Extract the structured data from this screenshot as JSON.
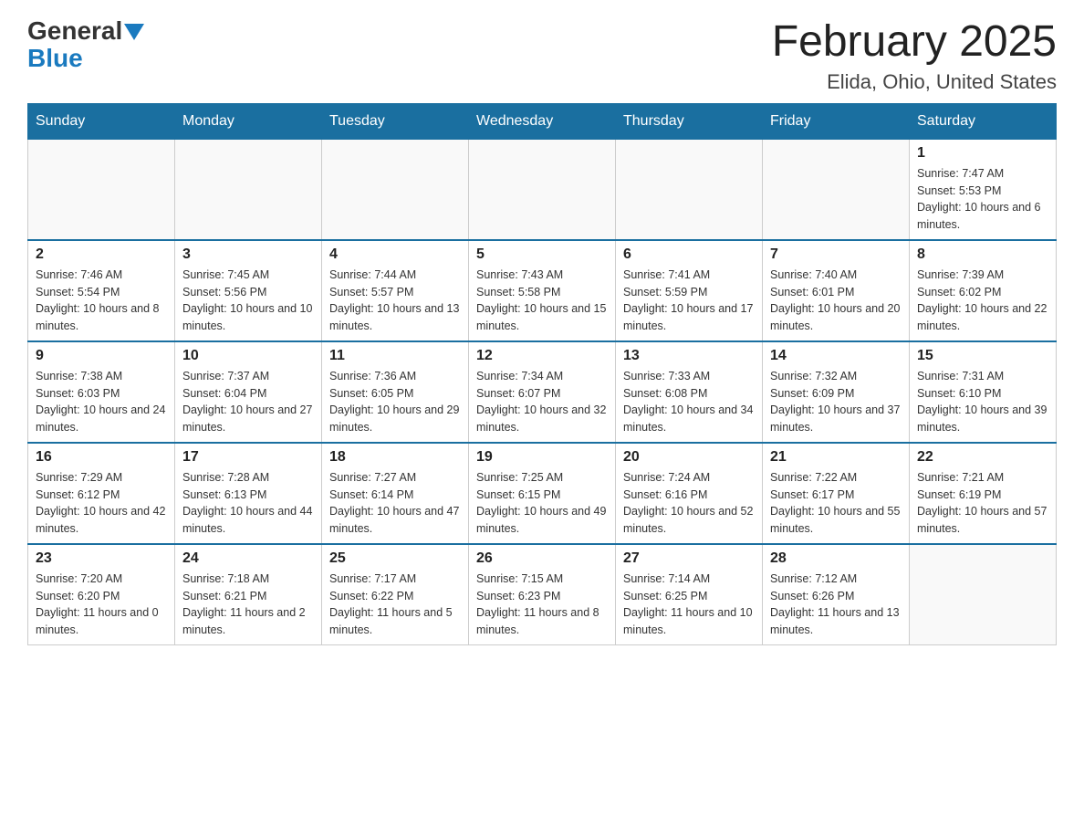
{
  "logo": {
    "text1": "General",
    "text2": "Blue"
  },
  "title": {
    "month_year": "February 2025",
    "location": "Elida, Ohio, United States"
  },
  "days_of_week": [
    "Sunday",
    "Monday",
    "Tuesday",
    "Wednesday",
    "Thursday",
    "Friday",
    "Saturday"
  ],
  "weeks": [
    [
      {
        "day": "",
        "info": ""
      },
      {
        "day": "",
        "info": ""
      },
      {
        "day": "",
        "info": ""
      },
      {
        "day": "",
        "info": ""
      },
      {
        "day": "",
        "info": ""
      },
      {
        "day": "",
        "info": ""
      },
      {
        "day": "1",
        "info": "Sunrise: 7:47 AM\nSunset: 5:53 PM\nDaylight: 10 hours and 6 minutes."
      }
    ],
    [
      {
        "day": "2",
        "info": "Sunrise: 7:46 AM\nSunset: 5:54 PM\nDaylight: 10 hours and 8 minutes."
      },
      {
        "day": "3",
        "info": "Sunrise: 7:45 AM\nSunset: 5:56 PM\nDaylight: 10 hours and 10 minutes."
      },
      {
        "day": "4",
        "info": "Sunrise: 7:44 AM\nSunset: 5:57 PM\nDaylight: 10 hours and 13 minutes."
      },
      {
        "day": "5",
        "info": "Sunrise: 7:43 AM\nSunset: 5:58 PM\nDaylight: 10 hours and 15 minutes."
      },
      {
        "day": "6",
        "info": "Sunrise: 7:41 AM\nSunset: 5:59 PM\nDaylight: 10 hours and 17 minutes."
      },
      {
        "day": "7",
        "info": "Sunrise: 7:40 AM\nSunset: 6:01 PM\nDaylight: 10 hours and 20 minutes."
      },
      {
        "day": "8",
        "info": "Sunrise: 7:39 AM\nSunset: 6:02 PM\nDaylight: 10 hours and 22 minutes."
      }
    ],
    [
      {
        "day": "9",
        "info": "Sunrise: 7:38 AM\nSunset: 6:03 PM\nDaylight: 10 hours and 24 minutes."
      },
      {
        "day": "10",
        "info": "Sunrise: 7:37 AM\nSunset: 6:04 PM\nDaylight: 10 hours and 27 minutes."
      },
      {
        "day": "11",
        "info": "Sunrise: 7:36 AM\nSunset: 6:05 PM\nDaylight: 10 hours and 29 minutes."
      },
      {
        "day": "12",
        "info": "Sunrise: 7:34 AM\nSunset: 6:07 PM\nDaylight: 10 hours and 32 minutes."
      },
      {
        "day": "13",
        "info": "Sunrise: 7:33 AM\nSunset: 6:08 PM\nDaylight: 10 hours and 34 minutes."
      },
      {
        "day": "14",
        "info": "Sunrise: 7:32 AM\nSunset: 6:09 PM\nDaylight: 10 hours and 37 minutes."
      },
      {
        "day": "15",
        "info": "Sunrise: 7:31 AM\nSunset: 6:10 PM\nDaylight: 10 hours and 39 minutes."
      }
    ],
    [
      {
        "day": "16",
        "info": "Sunrise: 7:29 AM\nSunset: 6:12 PM\nDaylight: 10 hours and 42 minutes."
      },
      {
        "day": "17",
        "info": "Sunrise: 7:28 AM\nSunset: 6:13 PM\nDaylight: 10 hours and 44 minutes."
      },
      {
        "day": "18",
        "info": "Sunrise: 7:27 AM\nSunset: 6:14 PM\nDaylight: 10 hours and 47 minutes."
      },
      {
        "day": "19",
        "info": "Sunrise: 7:25 AM\nSunset: 6:15 PM\nDaylight: 10 hours and 49 minutes."
      },
      {
        "day": "20",
        "info": "Sunrise: 7:24 AM\nSunset: 6:16 PM\nDaylight: 10 hours and 52 minutes."
      },
      {
        "day": "21",
        "info": "Sunrise: 7:22 AM\nSunset: 6:17 PM\nDaylight: 10 hours and 55 minutes."
      },
      {
        "day": "22",
        "info": "Sunrise: 7:21 AM\nSunset: 6:19 PM\nDaylight: 10 hours and 57 minutes."
      }
    ],
    [
      {
        "day": "23",
        "info": "Sunrise: 7:20 AM\nSunset: 6:20 PM\nDaylight: 11 hours and 0 minutes."
      },
      {
        "day": "24",
        "info": "Sunrise: 7:18 AM\nSunset: 6:21 PM\nDaylight: 11 hours and 2 minutes."
      },
      {
        "day": "25",
        "info": "Sunrise: 7:17 AM\nSunset: 6:22 PM\nDaylight: 11 hours and 5 minutes."
      },
      {
        "day": "26",
        "info": "Sunrise: 7:15 AM\nSunset: 6:23 PM\nDaylight: 11 hours and 8 minutes."
      },
      {
        "day": "27",
        "info": "Sunrise: 7:14 AM\nSunset: 6:25 PM\nDaylight: 11 hours and 10 minutes."
      },
      {
        "day": "28",
        "info": "Sunrise: 7:12 AM\nSunset: 6:26 PM\nDaylight: 11 hours and 13 minutes."
      },
      {
        "day": "",
        "info": ""
      }
    ]
  ]
}
